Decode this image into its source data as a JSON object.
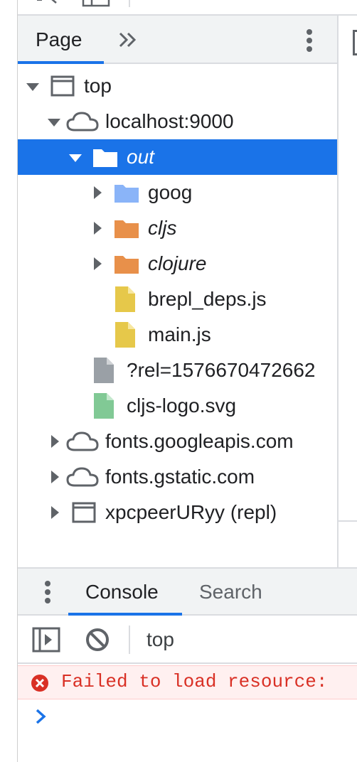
{
  "panel": {
    "tab_page": "Page",
    "more_tabs_icon": "»"
  },
  "tree": {
    "top": "top",
    "localhost": "localhost:9000",
    "out": "out",
    "goog": "goog",
    "cljs": "cljs",
    "clojure": "clojure",
    "brepl_deps": "brepl_deps.js",
    "main": "main.js",
    "rel": "?rel=1576670472662",
    "cljs_logo": "cljs-logo.svg",
    "fonts_googleapis": "fonts.googleapis.com",
    "fonts_gstatic": "fonts.gstatic.com",
    "xpcpeer": "xpcpeerURyy (repl)"
  },
  "drawer": {
    "tab_console": "Console",
    "tab_search": "Search"
  },
  "console": {
    "context": "top",
    "error_text": "Failed to load resource:",
    "prompt": "›"
  },
  "colors": {
    "accent": "#1a73e8",
    "folder_blue": "#8ab4f8",
    "folder_orange": "#e8904a",
    "file_yellow": "#e6c84a",
    "file_gray": "#9aa0a6",
    "file_green": "#81c995",
    "error": "#d93025"
  },
  "icons": [
    "frame-icon",
    "cloud-icon",
    "folder-icon",
    "file-icon",
    "kebab-menu-icon",
    "sidebar-toggle-icon",
    "clear-console-icon",
    "error-icon"
  ]
}
